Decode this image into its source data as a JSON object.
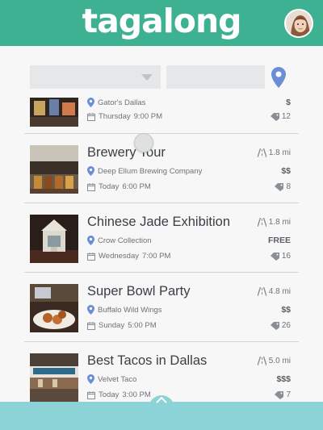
{
  "app": {
    "logo_text": "tagalong"
  },
  "colors": {
    "brand": "#3fb193",
    "pin": "#6b8fd6",
    "bottom_bar": "#8bd3d6"
  },
  "events": [
    {
      "title": "",
      "venue": "Gator's Dallas",
      "day": "Thursday",
      "time": "9:00 PM",
      "distance": "",
      "price": "$",
      "count": "12"
    },
    {
      "title": "Brewery Tour",
      "venue": "Deep Ellum Brewing Company",
      "day": "Today",
      "time": "6:00 PM",
      "distance": "1.8 mi",
      "price": "$$",
      "count": "8"
    },
    {
      "title": "Chinese Jade Exhibition",
      "venue": "Crow Collection",
      "day": "Wednesday",
      "time": "7:00 PM",
      "distance": "1.8 mi",
      "price": "FREE",
      "count": "16"
    },
    {
      "title": "Super Bowl Party",
      "venue": "Buffalo Wild Wings",
      "day": "Sunday",
      "time": "5:00 PM",
      "distance": "4.8 mi",
      "price": "$$",
      "count": "26"
    },
    {
      "title": "Best Tacos in Dallas",
      "venue": "Velvet Taco",
      "day": "Today",
      "time": "3:00 PM",
      "distance": "5.0 mi",
      "price": "$$$",
      "count": "7"
    }
  ]
}
